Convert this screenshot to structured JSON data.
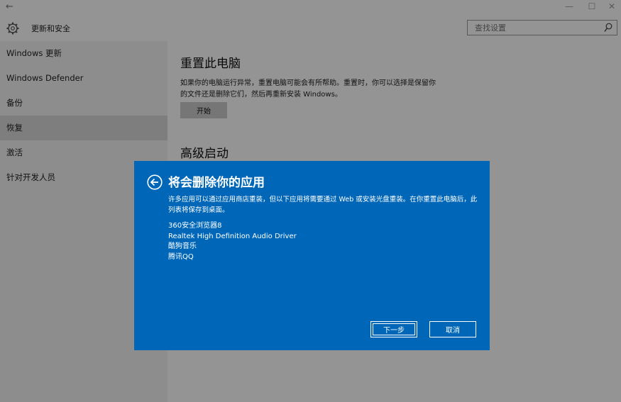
{
  "header": {
    "title": "更新和安全",
    "search_placeholder": "查找设置"
  },
  "sidebar": {
    "items": [
      {
        "label": "Windows 更新"
      },
      {
        "label": "Windows Defender"
      },
      {
        "label": "备份"
      },
      {
        "label": "恢复"
      },
      {
        "label": "激活"
      },
      {
        "label": "针对开发人员"
      }
    ]
  },
  "content": {
    "reset_title": "重置此电脑",
    "reset_desc": "如果你的电脑运行异常，重置电脑可能会有所帮助。重置时，你可以选择是保留你的文件还是删除它们，然后再重新安装 Windows。",
    "start_label": "开始",
    "advanced_title": "高级启动"
  },
  "dialog": {
    "title": "将会删除你的应用",
    "description": "许多应用可以通过应用商店重装，但以下应用将需要通过 Web 或安装光盘重装。在你重置此电脑后，此列表将保存到桌面。",
    "apps": [
      "360安全浏览器8",
      "Realtek High Definition Audio Driver",
      "酷狗音乐",
      "腾讯QQ"
    ],
    "next_label": "下一步",
    "cancel_label": "取消"
  },
  "colors": {
    "dialog_bg": "#0067b8",
    "sidebar_bg": "#f3f3f3",
    "active_item_bg": "#d9d9d9"
  },
  "icons": [
    "back-arrow-icon",
    "minimize-icon",
    "maximize-icon",
    "close-icon",
    "gear-icon",
    "search-icon",
    "dialog-back-icon"
  ]
}
